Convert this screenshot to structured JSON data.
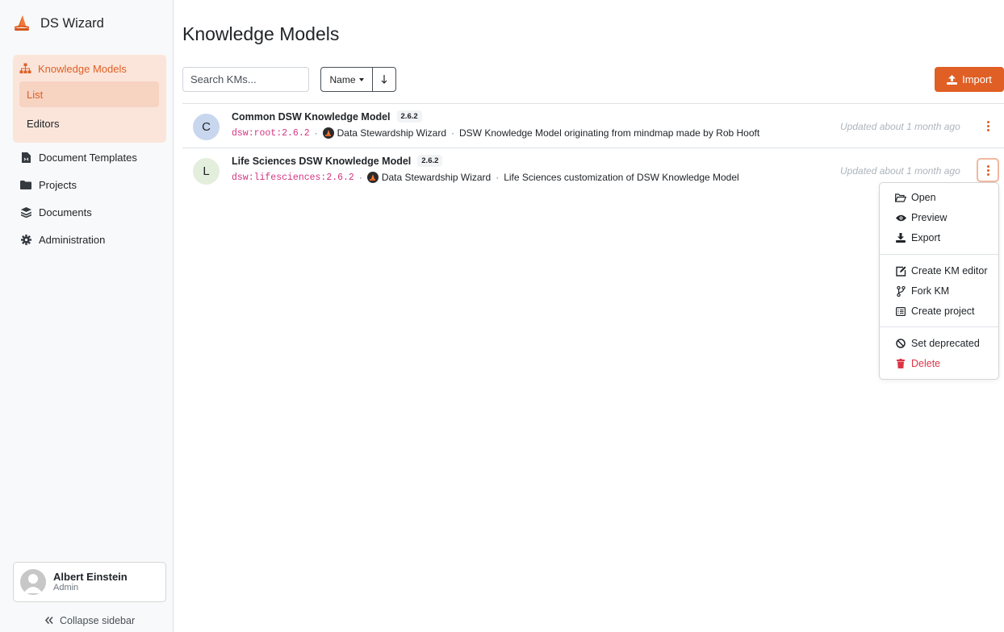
{
  "brand": {
    "name": "DS Wizard"
  },
  "sidebar": {
    "group": {
      "label": "Knowledge Models",
      "subitems": [
        {
          "label": "List"
        },
        {
          "label": "Editors"
        }
      ]
    },
    "items": [
      {
        "label": "Document Templates",
        "icon": "document-template-icon"
      },
      {
        "label": "Projects",
        "icon": "folder-icon"
      },
      {
        "label": "Documents",
        "icon": "layers-icon"
      },
      {
        "label": "Administration",
        "icon": "gear-icon"
      }
    ],
    "user": {
      "name": "Albert Einstein",
      "role": "Admin"
    },
    "collapse_label": "Collapse sidebar"
  },
  "page": {
    "title": "Knowledge Models",
    "search_placeholder": "Search KMs...",
    "sort_label": "Name",
    "import_label": "Import"
  },
  "knowledge_models": [
    {
      "initial": "C",
      "avatar_color": "#c8d6ee",
      "name": "Common DSW Knowledge Model",
      "version": "2.6.2",
      "id": "dsw:root:2.6.2",
      "organization": "Data Stewardship Wizard",
      "description": "DSW Knowledge Model originating from mindmap made by Rob Hooft",
      "updated": "Updated about 1 month ago"
    },
    {
      "initial": "L",
      "avatar_color": "#e3eedc",
      "name": "Life Sciences DSW Knowledge Model",
      "version": "2.6.2",
      "id": "dsw:lifesciences:2.6.2",
      "organization": "Data Stewardship Wizard",
      "description": "Life Sciences customization of DSW Knowledge Model",
      "updated": "Updated about 1 month ago"
    }
  ],
  "dropdown": {
    "items": [
      {
        "label": "Open",
        "icon": "folder-open-icon"
      },
      {
        "label": "Preview",
        "icon": "eye-icon"
      },
      {
        "label": "Export",
        "icon": "download-icon"
      },
      {
        "label": "Create KM editor",
        "icon": "edit-icon"
      },
      {
        "label": "Fork KM",
        "icon": "fork-icon"
      },
      {
        "label": "Create project",
        "icon": "list-icon"
      },
      {
        "label": "Set deprecated",
        "icon": "ban-icon"
      },
      {
        "label": "Delete",
        "icon": "trash-icon"
      }
    ]
  },
  "colors": {
    "accent": "#e05f24",
    "danger": "#dc3545"
  }
}
